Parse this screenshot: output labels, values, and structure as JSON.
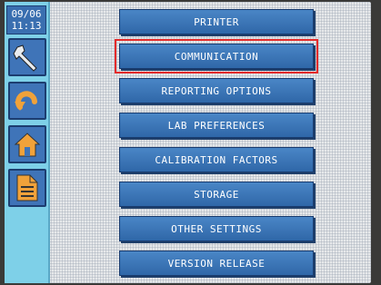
{
  "status": {
    "date": "09/06",
    "time": "11:13"
  },
  "sidebar": {
    "items": [
      {
        "name": "settings-wrench-icon"
      },
      {
        "name": "back-arrow-icon"
      },
      {
        "name": "home-icon"
      },
      {
        "name": "report-document-icon"
      }
    ]
  },
  "menu": {
    "items": [
      {
        "label": "PRINTER"
      },
      {
        "label": "COMMUNICATION",
        "selected": true
      },
      {
        "label": "REPORTING OPTIONS"
      },
      {
        "label": "LAB PREFERENCES"
      },
      {
        "label": "CALIBRATION FACTORS"
      },
      {
        "label": "STORAGE"
      },
      {
        "label": "OTHER SETTINGS"
      },
      {
        "label": "VERSION RELEASE"
      }
    ]
  },
  "colors": {
    "sidebar": "#7ed0e8",
    "button": "#2f67a8",
    "selection_outline": "#e32b2b"
  }
}
